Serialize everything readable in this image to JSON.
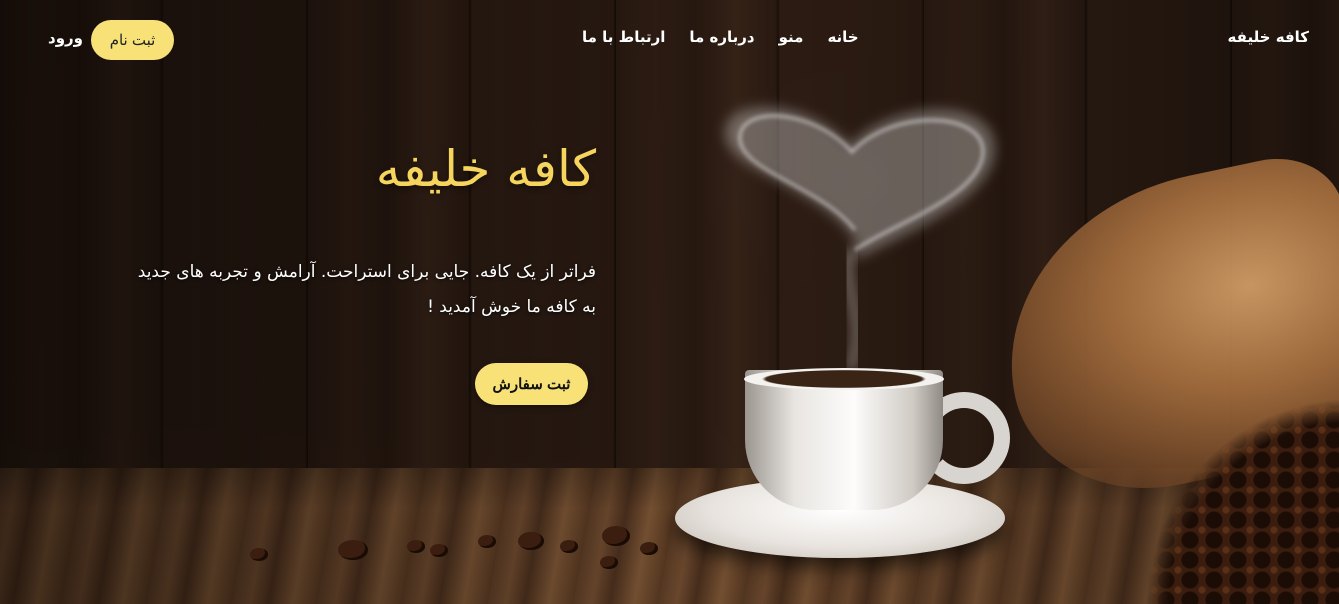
{
  "nav": {
    "brand": "کافه خلیفه",
    "menu": [
      "خانه",
      "منو",
      "درباره ما",
      "ارتباط با ما"
    ],
    "signup_label": "ثبت نام",
    "login_label": "ورود"
  },
  "hero": {
    "title": "کافه خلیفه",
    "tagline_line1": "فراتر از یک کافه. جایی برای استراحت. آرامش و تجربه های جدید",
    "tagline_line2": "به کافه ما خوش آمدید !",
    "order_label": "ثبت سفارش"
  },
  "colors": {
    "accent": "#f8e278",
    "title": "#f6d55e"
  }
}
